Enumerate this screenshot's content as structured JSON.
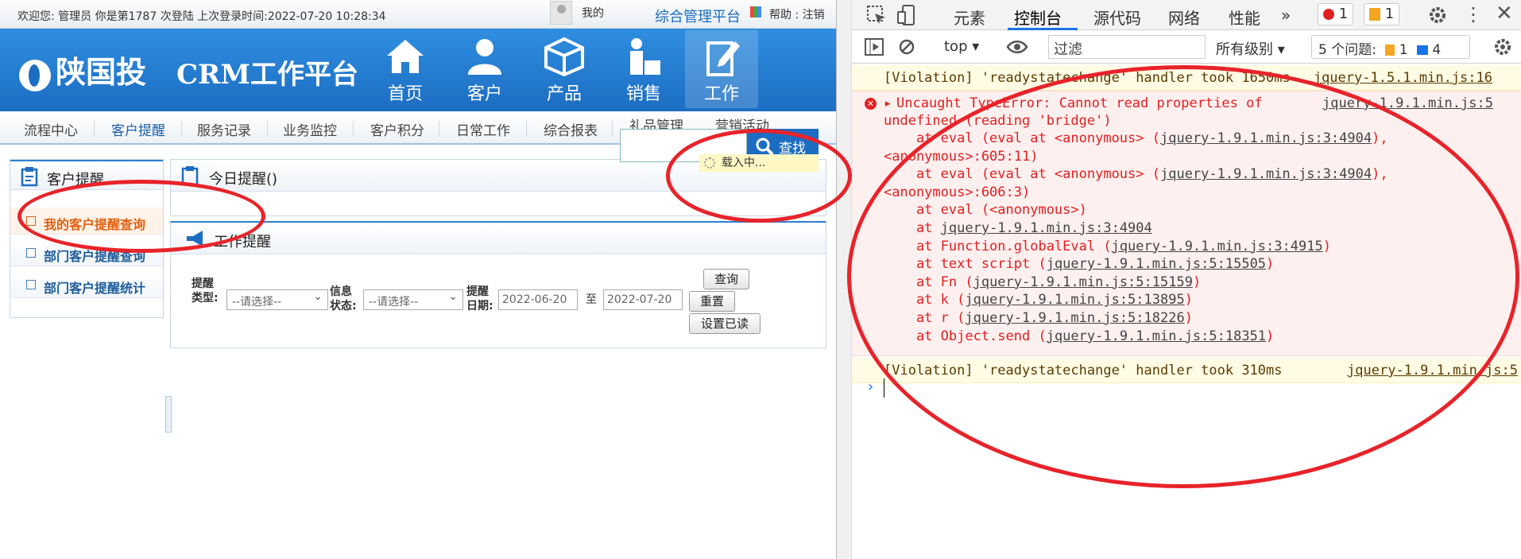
{
  "crm": {
    "topbar": {
      "welcome": "欢迎您: 管理员 你是第1787 次登陆 上次登录时间:2022-07-20 10:28:34",
      "mine": "我的",
      "platform": "综合管理平台",
      "help_logout": "帮助 : 注销"
    },
    "banner": {
      "logo": "陕国投",
      "title": "CRM工作平台",
      "nav": [
        {
          "label": "首页",
          "icon": "home-icon"
        },
        {
          "label": "客户",
          "icon": "customer-icon"
        },
        {
          "label": "产品",
          "icon": "cube-icon"
        },
        {
          "label": "销售",
          "icon": "sales-icon"
        },
        {
          "label": "工作",
          "icon": "edit-icon",
          "active": true
        }
      ]
    },
    "menu": [
      "流程中心",
      "客户提醒",
      "服务记录",
      "业务监控",
      "客户积分",
      "日常工作",
      "综合报表",
      "礼品管理",
      "营销活动"
    ],
    "search": {
      "button": "查找",
      "loading": "载入中..."
    },
    "sidebar": {
      "title": "客户提醒",
      "items": [
        "我的客户提醒查询",
        "部门客户提醒查询",
        "部门客户提醒统计"
      ]
    },
    "today": {
      "title": "今日提醒()"
    },
    "work": {
      "title": "工作提醒",
      "type_label": "提醒类型:",
      "type_value": "--请选择--",
      "status_label": "信息状态:",
      "status_value": "--请选择--",
      "date_label": "提醒日期:",
      "date_from": "2022-06-20",
      "to": "至",
      "date_to": "2022-07-20",
      "query": "查询",
      "reset": "重置",
      "mark_read": "设置已读"
    }
  },
  "devtools": {
    "tabs": [
      "元素",
      "控制台",
      "源代码",
      "网络",
      "性能"
    ],
    "more": "»",
    "error_count": "1",
    "warn_count": "1",
    "context": "top",
    "filter_placeholder": "过滤",
    "levels": "所有级别",
    "issues": "5 个问题:",
    "issues_warn": "1",
    "issues_info": "4",
    "console": {
      "violation1": "[Violation] 'readystatechange' handler took 1650ms",
      "violation1_src": "jquery-1.5.1.min.js:16",
      "error_src": "jquery-1.9.1.min.js:5",
      "error_msg_1": "Uncaught TypeError: Cannot read properties of",
      "error_msg_2": "undefined (reading 'bridge')",
      "stack": [
        {
          "pre": "    at eval (eval at <anonymous> (",
          "link": "jquery-1.9.1.min.js:3:4904",
          "post": "),"
        },
        {
          "pre": "<anonymous>:605:11)",
          "link": "",
          "post": ""
        },
        {
          "pre": "    at eval (eval at <anonymous> (",
          "link": "jquery-1.9.1.min.js:3:4904",
          "post": "),"
        },
        {
          "pre": "<anonymous>:606:3)",
          "link": "",
          "post": ""
        },
        {
          "pre": "    at eval (<anonymous>)",
          "link": "",
          "post": ""
        },
        {
          "pre": "    at ",
          "link": "jquery-1.9.1.min.js:3:4904",
          "post": ""
        },
        {
          "pre": "    at Function.globalEval (",
          "link": "jquery-1.9.1.min.js:3:4915",
          "post": ")"
        },
        {
          "pre": "    at text script (",
          "link": "jquery-1.9.1.min.js:5:15505",
          "post": ")"
        },
        {
          "pre": "    at Fn (",
          "link": "jquery-1.9.1.min.js:5:15159",
          "post": ")"
        },
        {
          "pre": "    at k (",
          "link": "jquery-1.9.1.min.js:5:13895",
          "post": ")"
        },
        {
          "pre": "    at r (",
          "link": "jquery-1.9.1.min.js:5:18226",
          "post": ")"
        },
        {
          "pre": "    at Object.send (",
          "link": "jquery-1.9.1.min.js:5:18351",
          "post": ")"
        }
      ],
      "violation2": "[Violation] 'readystatechange' handler took 310ms",
      "violation2_src": "jquery-1.9.1.min.js:5",
      "prompt": "›"
    }
  },
  "colors": {
    "accent": "#1c6dc2",
    "annotation": "#e8232a",
    "error": "#e02020",
    "violation_bg": "#fffbe5"
  }
}
